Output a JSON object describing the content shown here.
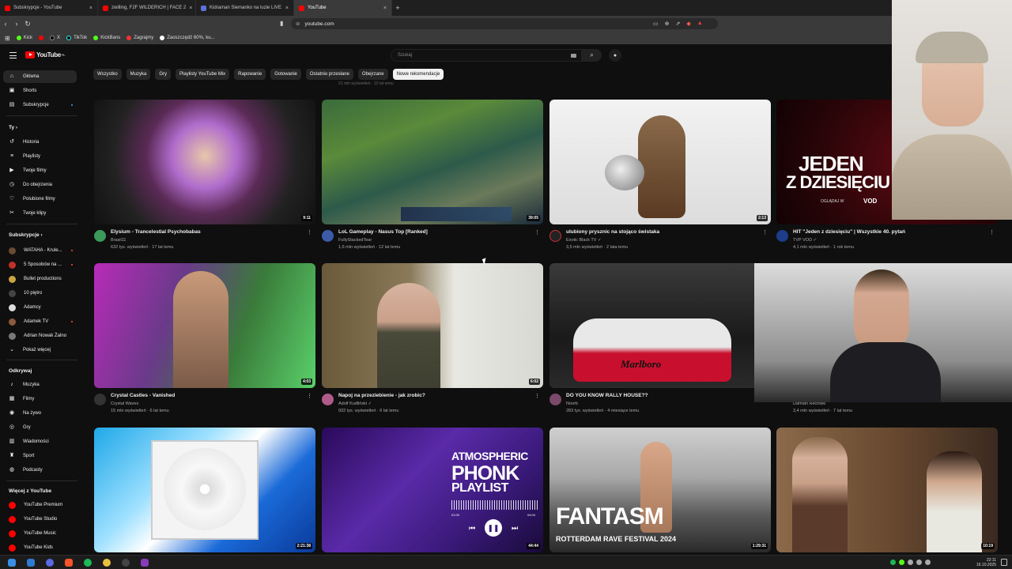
{
  "browser": {
    "tabs": [
      {
        "label": "Subskrypcje - YouTube",
        "active": false
      },
      {
        "label": "zwilling, F2F WILDERICH | FACE 2",
        "active": false
      },
      {
        "label": "Kidraman Siemanko na luzie LIVE",
        "active": false
      },
      {
        "label": "YouTube",
        "active": true
      }
    ],
    "url": "youtube.com",
    "bookmarks": [
      "Kick",
      "X",
      "TikTok",
      "KickBans",
      "Zagrajmy",
      "Zaoszczędź 60%, ku..."
    ]
  },
  "header": {
    "logo": "YouTube",
    "logo_region": "PL",
    "search_placeholder": "Szukaj"
  },
  "chips": [
    "Wszystko",
    "Muzyka",
    "Gry",
    "Playlisty YouTube Mix",
    "Rapowanie",
    "Gotowanie",
    "Ostatnio przesłane",
    "Obejrzane",
    "Nowe rekomendacje"
  ],
  "active_chip": "Nowe rekomendacje",
  "sidebar": {
    "main": [
      {
        "label": "Główna",
        "icon": "home-icon"
      },
      {
        "label": "Shorts",
        "icon": "shorts-icon"
      },
      {
        "label": "Subskrypcje",
        "icon": "subscriptions-icon"
      }
    ],
    "you_header": "Ty",
    "you": [
      {
        "label": "Historia",
        "icon": "history-icon"
      },
      {
        "label": "Playlisty",
        "icon": "playlist-icon"
      },
      {
        "label": "Twoje filmy",
        "icon": "your-videos-icon"
      },
      {
        "label": "Do obejrzenia",
        "icon": "watch-later-icon"
      },
      {
        "label": "Polubione filmy",
        "icon": "like-icon"
      },
      {
        "label": "Twoje klipy",
        "icon": "clips-icon"
      }
    ],
    "subs_header": "Subskrypcje",
    "subs": [
      {
        "label": "WATAHA - Krule...",
        "color": "#6b4a2f",
        "live": true
      },
      {
        "label": "5 Sposobów na ...",
        "color": "#c3302a",
        "live": true
      },
      {
        "label": "Bullet productions",
        "color": "#c9a443",
        "live": false
      },
      {
        "label": "10 piętro",
        "color": "#444444",
        "live": false
      },
      {
        "label": "Adamcy",
        "color": "#dddddd",
        "live": false
      },
      {
        "label": "Adamek TV",
        "color": "#8b5a3c",
        "live": true
      },
      {
        "label": "Adrian Nowak Żalno",
        "color": "#7a7a7a",
        "live": false
      }
    ],
    "show_more": "Pokaż więcej",
    "explore_header": "Odkrywaj",
    "explore": [
      {
        "label": "Muzyka",
        "icon": "music-icon"
      },
      {
        "label": "Filmy",
        "icon": "film-icon"
      },
      {
        "label": "Na żywo",
        "icon": "live-icon"
      },
      {
        "label": "Gry",
        "icon": "gaming-icon"
      },
      {
        "label": "Wiadomości",
        "icon": "news-icon"
      },
      {
        "label": "Sport",
        "icon": "sport-icon"
      },
      {
        "label": "Podcasty",
        "icon": "podcast-icon"
      }
    ],
    "more_header": "Więcej z YouTube",
    "more": [
      {
        "label": "YouTube Premium"
      },
      {
        "label": "YouTube Studio"
      },
      {
        "label": "YouTube Music"
      },
      {
        "label": "YouTube Kids"
      }
    ]
  },
  "partial_text": "21 mln wyświetleń · 10 lat temu",
  "videos": [
    {
      "title": "Elysium - Trancelestial Psychobabas",
      "channel": "Brasil11",
      "stats": "632 tys. wyświetleń · 17 lat temu",
      "duration": "9:11",
      "verified": false
    },
    {
      "title": "LoL Gameplay - Nasus Top [Ranked]",
      "channel": "FullyStackedTear",
      "stats": "1,6 mln wyświetleń · 12 lat temu",
      "duration": "39:05",
      "verified": false
    },
    {
      "title": "ulubiony prysznic na stojąco świstaka",
      "channel": "Exotic Black TV",
      "stats": "3,5 mln wyświetleń · 2 lata temu",
      "duration": "2:13",
      "verified": true
    },
    {
      "title": "HIT \"Jeden z dziesięciu\" | Wszystkie 40. pytań",
      "channel": "TVP VOD",
      "stats": "4,1 mln wyświetleń · 1 rok temu",
      "duration": "",
      "verified": true,
      "thumb_text": [
        "JEDEN",
        "Z DZIESIĘCIU"
      ],
      "thumb_small": "OGLĄDAJ W",
      "thumb_brand": "VOD"
    },
    {
      "title": "Crystal Castles - Vanished",
      "channel": "Crystal Waves",
      "stats": "15 mln wyświetleń · 6 lat temu",
      "duration": "4:03",
      "verified": false
    },
    {
      "title": "Napoj na przeziebienie - jak zrobic?",
      "channel": "Adolf Kudliński",
      "stats": "932 tys. wyświetleń · 6 lat temu",
      "duration": "6:02",
      "verified": true
    },
    {
      "title": "DO YOU KNOW RALLY HOUSE??",
      "channel": "Noorb",
      "stats": "283 tys. wyświetleń · 4 miesiące temu",
      "duration": "",
      "verified": false,
      "thumb_text": [
        "Marlboro"
      ]
    },
    {
      "title": "",
      "channel": "Damian Reciński",
      "stats": "3,4 mln wyświetleń · 7 lat temu",
      "duration": "",
      "verified": false
    },
    {
      "title": "",
      "channel": "",
      "stats": "",
      "duration": "2:21:38",
      "verified": false
    },
    {
      "title": "",
      "channel": "",
      "stats": "",
      "duration": "44:44",
      "verified": false,
      "thumb_text": [
        "ATMOSPHERIC",
        "PHONK",
        "PLAYLIST"
      ],
      "player_times": [
        "01:00",
        "04:04"
      ]
    },
    {
      "title": "",
      "channel": "",
      "stats": "",
      "duration": "1:29:31",
      "verified": false,
      "thumb_text": [
        "FANTASM",
        "ROTTERDAM RAVE FESTIVAL 2024"
      ]
    },
    {
      "title": "",
      "channel": "",
      "stats": "",
      "duration": "10:19",
      "verified": false
    }
  ],
  "taskbar": {
    "time": "22:11",
    "date": "16.10.2025"
  },
  "colors": {
    "bg": "#0f0f0f",
    "accent": "#ff0000",
    "chip": "#272727",
    "text_secondary": "#aaaaaa"
  }
}
